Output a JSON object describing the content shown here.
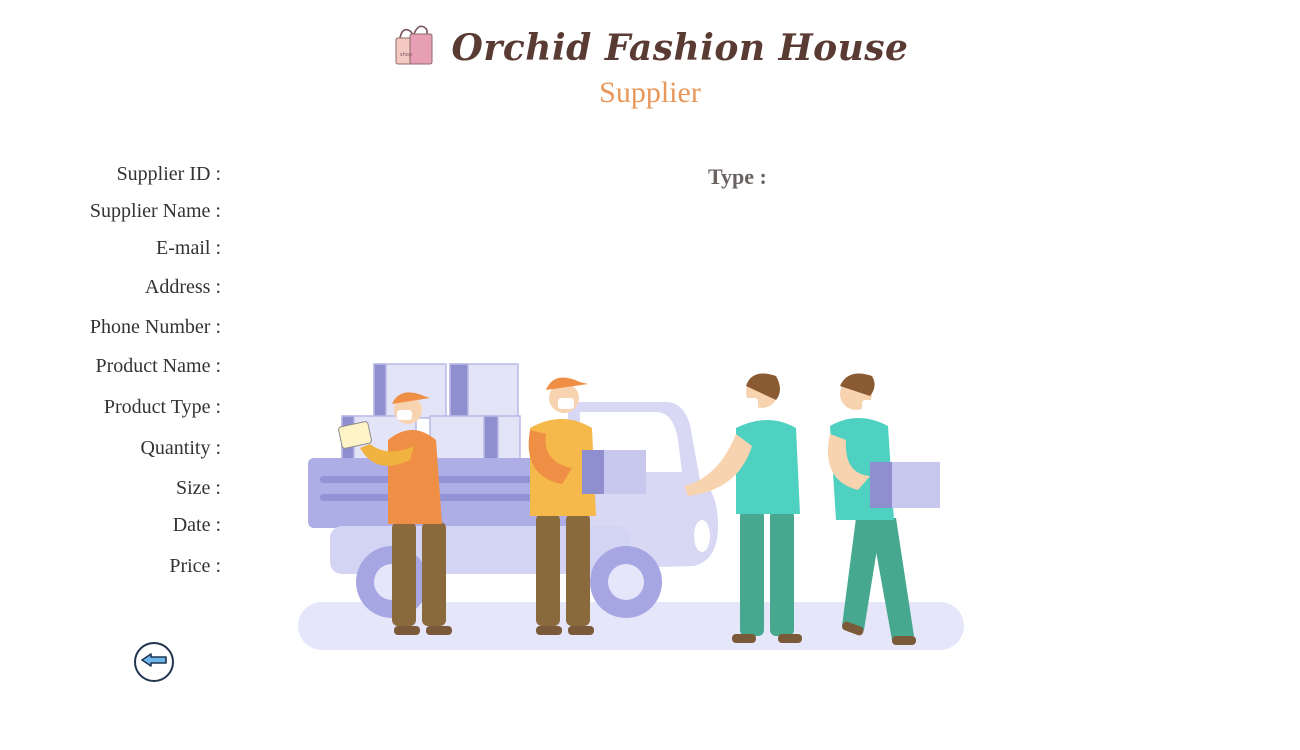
{
  "header": {
    "brand_title": "Orchid Fashion House",
    "page_subtitle": "Supplier",
    "logo_icon": "shopping-bags-icon"
  },
  "form": {
    "fields": [
      {
        "label": "Supplier ID :"
      },
      {
        "label": "Supplier Name :"
      },
      {
        "label": "E-mail :"
      },
      {
        "label": "Address :"
      },
      {
        "label": "Phone Number :"
      },
      {
        "label": "Product Name :"
      },
      {
        "label": "Product Type :"
      },
      {
        "label": "Quantity :"
      },
      {
        "label": "Size :"
      },
      {
        "label": "Date :"
      },
      {
        "label": "Price :"
      }
    ],
    "type_label": "Type :"
  },
  "navigation": {
    "back_icon": "arrow-left-icon"
  },
  "colors": {
    "brand": "#5a3b33",
    "subtitle": "#e8975b",
    "truck": "#c8c8ee",
    "back_border": "#22344f"
  }
}
